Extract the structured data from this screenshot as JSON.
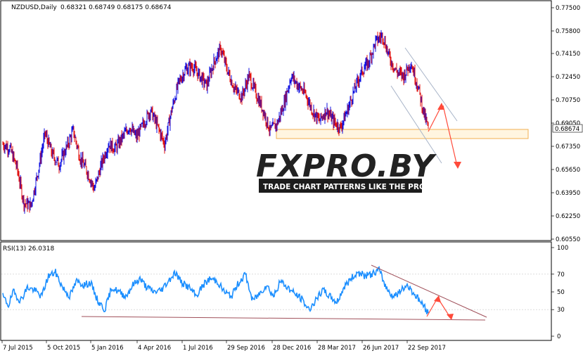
{
  "header": {
    "symbol_label": "NZDUSD,Daily",
    "ohlc": "0.68321 0.68749 0.68175 0.68674"
  },
  "rsi_panel": {
    "label": "RSI(13) 26.0318"
  },
  "watermark": {
    "brand": "FXPRO.BY",
    "tagline": "TRADE CHART PATTERNS LIKE THE PROS"
  },
  "colors": {
    "bull": "#1010e0",
    "bear": "#e01010",
    "rsi_line": "#1e90ff",
    "trend_line": "#a0505a",
    "arrow": "#ff4a3a",
    "channel": "#a8b4c8",
    "zone_border": "#f0b050",
    "zone_fill": "#fff5e0",
    "grid": "#e6e6e6"
  },
  "chart_data": [
    {
      "type": "candlestick",
      "title": "NZDUSD,Daily",
      "last_price_label": "0.68674",
      "y_ticks": [
        "0.77500",
        "0.75800",
        "0.74150",
        "0.72450",
        "0.70750",
        "0.69050",
        "0.67350",
        "0.65650",
        "0.63950",
        "0.62250",
        "0.60550"
      ],
      "ylim": [
        0.6055,
        0.775
      ],
      "x_tick_labels": [
        "7 Jul 2015",
        "5 Oct 2015",
        "5 Jan 2016",
        "4 Apr 2016",
        "1 Jul 2016",
        "29 Sep 2016",
        "28 Dec 2016",
        "28 Mar 2017",
        "26 Jun 2017",
        "22 Sep 2017"
      ],
      "price_path": [
        [
          0,
          0.675
        ],
        [
          10,
          0.672
        ],
        [
          20,
          0.658
        ],
        [
          30,
          0.632
        ],
        [
          40,
          0.63
        ],
        [
          50,
          0.655
        ],
        [
          60,
          0.683
        ],
        [
          70,
          0.668
        ],
        [
          80,
          0.66
        ],
        [
          90,
          0.672
        ],
        [
          100,
          0.685
        ],
        [
          110,
          0.665
        ],
        [
          120,
          0.655
        ],
        [
          130,
          0.642
        ],
        [
          140,
          0.66
        ],
        [
          150,
          0.675
        ],
        [
          160,
          0.672
        ],
        [
          170,
          0.68
        ],
        [
          180,
          0.688
        ],
        [
          190,
          0.68
        ],
        [
          200,
          0.69
        ],
        [
          210,
          0.7
        ],
        [
          220,
          0.688
        ],
        [
          230,
          0.675
        ],
        [
          240,
          0.7
        ],
        [
          250,
          0.72
        ],
        [
          260,
          0.73
        ],
        [
          270,
          0.732
        ],
        [
          280,
          0.725
        ],
        [
          290,
          0.718
        ],
        [
          300,
          0.735
        ],
        [
          310,
          0.745
        ],
        [
          320,
          0.728
        ],
        [
          330,
          0.715
        ],
        [
          340,
          0.71
        ],
        [
          350,
          0.725
        ],
        [
          360,
          0.712
        ],
        [
          370,
          0.7
        ],
        [
          380,
          0.685
        ],
        [
          390,
          0.69
        ],
        [
          400,
          0.705
        ],
        [
          410,
          0.725
        ],
        [
          420,
          0.718
        ],
        [
          430,
          0.712
        ],
        [
          440,
          0.7
        ],
        [
          450,
          0.692
        ],
        [
          460,
          0.7
        ],
        [
          470,
          0.692
        ],
        [
          480,
          0.687
        ],
        [
          490,
          0.7
        ],
        [
          500,
          0.715
        ],
        [
          510,
          0.728
        ],
        [
          520,
          0.735
        ],
        [
          530,
          0.75
        ],
        [
          540,
          0.755
        ],
        [
          550,
          0.738
        ],
        [
          560,
          0.728
        ],
        [
          570,
          0.725
        ],
        [
          580,
          0.735
        ],
        [
          590,
          0.718
        ],
        [
          600,
          0.695
        ],
        [
          605,
          0.68674
        ]
      ],
      "support_zone": {
        "from": 0.6815,
        "to": 0.688
      },
      "annotations": [
        "support zone",
        "descending channel",
        "projection up",
        "projection down"
      ]
    },
    {
      "type": "line",
      "title": "RSI(13) 26.0318",
      "series_name": "RSI(13)",
      "last_value": 26.0318,
      "y_ticks": [
        "100",
        "70",
        "50",
        "30",
        "0"
      ],
      "ylim": [
        0,
        100
      ],
      "values_by_x": [
        [
          0,
          45
        ],
        [
          8,
          35
        ],
        [
          15,
          50
        ],
        [
          25,
          40
        ],
        [
          35,
          55
        ],
        [
          45,
          52
        ],
        [
          55,
          45
        ],
        [
          65,
          68
        ],
        [
          75,
          72
        ],
        [
          85,
          55
        ],
        [
          95,
          45
        ],
        [
          105,
          62
        ],
        [
          115,
          58
        ],
        [
          125,
          60
        ],
        [
          135,
          40
        ],
        [
          145,
          30
        ],
        [
          155,
          55
        ],
        [
          165,
          50
        ],
        [
          175,
          45
        ],
        [
          185,
          58
        ],
        [
          195,
          65
        ],
        [
          205,
          55
        ],
        [
          215,
          50
        ],
        [
          225,
          52
        ],
        [
          235,
          62
        ],
        [
          245,
          72
        ],
        [
          255,
          60
        ],
        [
          265,
          55
        ],
        [
          275,
          45
        ],
        [
          285,
          58
        ],
        [
          295,
          65
        ],
        [
          305,
          62
        ],
        [
          315,
          50
        ],
        [
          325,
          45
        ],
        [
          335,
          60
        ],
        [
          345,
          70
        ],
        [
          355,
          40
        ],
        [
          365,
          48
        ],
        [
          375,
          58
        ],
        [
          385,
          45
        ],
        [
          395,
          62
        ],
        [
          405,
          55
        ],
        [
          415,
          48
        ],
        [
          425,
          42
        ],
        [
          435,
          30
        ],
        [
          445,
          40
        ],
        [
          455,
          52
        ],
        [
          465,
          45
        ],
        [
          475,
          38
        ],
        [
          485,
          55
        ],
        [
          495,
          65
        ],
        [
          505,
          72
        ],
        [
          515,
          68
        ],
        [
          525,
          70
        ],
        [
          535,
          75
        ],
        [
          545,
          55
        ],
        [
          555,
          45
        ],
        [
          565,
          50
        ],
        [
          575,
          58
        ],
        [
          585,
          48
        ],
        [
          595,
          38
        ],
        [
          605,
          26.03
        ]
      ],
      "trend_lines": [
        "flat support line",
        "descending resistance line"
      ]
    }
  ]
}
